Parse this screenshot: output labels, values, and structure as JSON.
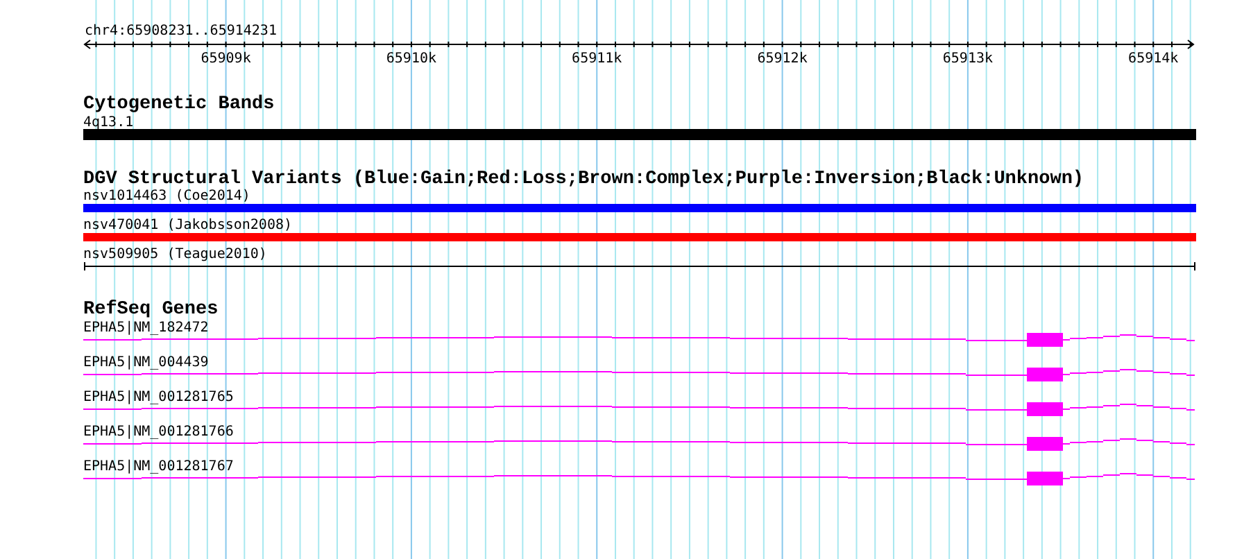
{
  "ruler": {
    "location": "chr4:65908231..65914231",
    "ticks": [
      "65909k",
      "65910k",
      "65911k",
      "65912k",
      "65913k",
      "65914k"
    ]
  },
  "cytogenetic_bands": {
    "title": "Cytogenetic Bands",
    "bands": [
      {
        "label": "4q13.1"
      }
    ]
  },
  "dgv_structural_variants": {
    "title": "DGV Structural Variants (Blue:Gain;Red:Loss;Brown:Complex;Purple:Inversion;Black:Unknown)",
    "items": [
      {
        "label": "nsv1014463 (Coe2014)",
        "kind": "bar",
        "color": "#0000ff"
      },
      {
        "label": "nsv470041 (Jakobsson2008)",
        "kind": "bar",
        "color": "#ff0000"
      },
      {
        "label": "nsv509905 (Teague2010)",
        "kind": "line",
        "color": "#000000"
      }
    ]
  },
  "refseq_genes": {
    "title": "RefSeq Genes",
    "items": [
      {
        "label": "EPHA5|NM_182472"
      },
      {
        "label": "EPHA5|NM_004439"
      },
      {
        "label": "EPHA5|NM_001281765"
      },
      {
        "label": "EPHA5|NM_001281766"
      },
      {
        "label": "EPHA5|NM_001281767"
      }
    ]
  }
}
